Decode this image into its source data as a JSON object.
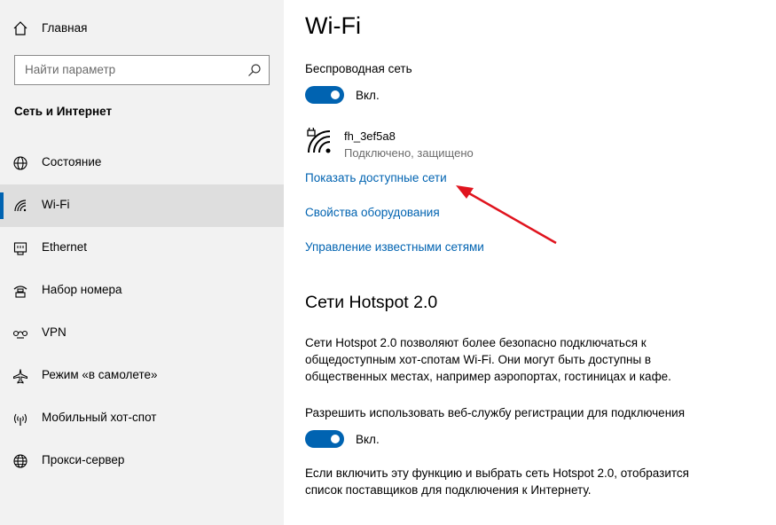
{
  "sidebar": {
    "home_label": "Главная",
    "search_placeholder": "Найти параметр",
    "section_title": "Сеть и Интернет",
    "items": [
      {
        "label": "Состояние",
        "icon": "globe-icon"
      },
      {
        "label": "Wi-Fi",
        "icon": "wifi-icon",
        "active": true
      },
      {
        "label": "Ethernet",
        "icon": "ethernet-icon"
      },
      {
        "label": "Набор номера",
        "icon": "dialup-icon"
      },
      {
        "label": "VPN",
        "icon": "vpn-icon"
      },
      {
        "label": "Режим «в самолете»",
        "icon": "airplane-icon"
      },
      {
        "label": "Мобильный хот-спот",
        "icon": "hotspot-icon"
      },
      {
        "label": "Прокси-сервер",
        "icon": "proxy-globe-icon"
      }
    ]
  },
  "main": {
    "title": "Wi-Fi",
    "wireless_label": "Беспроводная сеть",
    "wireless_toggle": {
      "state": "on",
      "label": "Вкл."
    },
    "network": {
      "name": "fh_3ef5a8",
      "status": "Подключено, защищено",
      "icon": "secured-wifi-icon"
    },
    "links": {
      "show_networks": "Показать доступные сети",
      "hardware_props": "Свойства оборудования",
      "manage_known": "Управление известными сетями"
    },
    "hotspot": {
      "heading": "Сети Hotspot 2.0",
      "description": "Сети Hotspot 2.0 позволяют более безопасно подключаться к общедоступным хот-спотам Wi-Fi. Они могут быть доступны в общественных местах, например аэропортах, гостиницах и кафе.",
      "registration_label": "Разрешить использовать веб-службу регистрации для подключения",
      "registration_toggle": {
        "state": "on",
        "label": "Вкл."
      },
      "footer_text": "Если включить эту функцию и выбрать сеть Hotspot 2.0, отобразится список поставщиков для подключения к Интернету."
    }
  },
  "colors": {
    "accent": "#0063b1",
    "sidebar_bg": "#f2f2f2",
    "active_item_bg": "#dedede",
    "annotation_arrow": "#e0141e"
  }
}
